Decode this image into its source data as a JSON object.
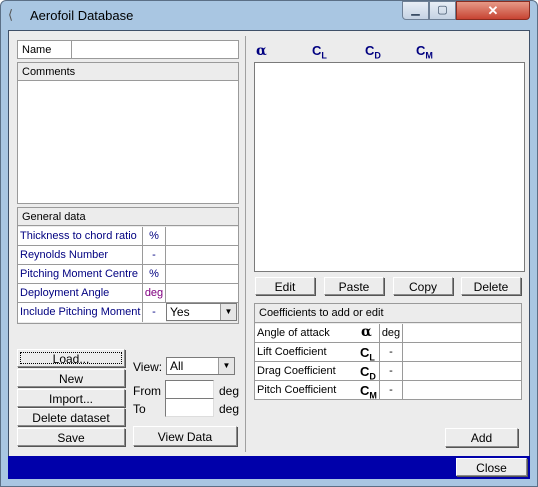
{
  "window": {
    "title": "Aerofoil Database",
    "close_glyph": "✕",
    "min_glyph": "▁",
    "max_glyph": "▢"
  },
  "name_label": "Name",
  "comments_label": "Comments",
  "general": {
    "header": "General data",
    "rows": [
      {
        "label": "Thickness to chord ratio",
        "unit": "%"
      },
      {
        "label": "Reynolds Number",
        "unit": "-"
      },
      {
        "label": "Pitching Moment Centre",
        "unit": "%"
      },
      {
        "label": "Deployment Angle",
        "unit": "deg"
      },
      {
        "label": "Include Pitching Moment",
        "unit": "-"
      }
    ],
    "include_value": "Yes"
  },
  "left_buttons": {
    "load": "Load...",
    "new": "New",
    "import": "Import...",
    "delete": "Delete dataset",
    "save": "Save"
  },
  "view": {
    "label": "View:",
    "value": "All",
    "from": "From",
    "to": "To",
    "deg1": "deg",
    "deg2": "deg",
    "view_data": "View Data"
  },
  "table_headers": {
    "alpha": "α",
    "cl": "C",
    "cl_sub": "L",
    "cd": "C",
    "cd_sub": "D",
    "cm": "C",
    "cm_sub": "M"
  },
  "table_buttons": {
    "edit": "Edit",
    "paste": "Paste",
    "copy": "Copy",
    "delete": "Delete"
  },
  "coeffs": {
    "header": "Coefficients to add or edit",
    "rows": [
      {
        "label": "Angle of attack",
        "sym": "α",
        "unit": "deg"
      },
      {
        "label": "Lift Coefficient",
        "sym": "C",
        "sub": "L",
        "unit": "-"
      },
      {
        "label": "Drag Coefficient",
        "sym": "C",
        "sub": "D",
        "unit": "-"
      },
      {
        "label": "Pitch Coefficient",
        "sym": "C",
        "sub": "M",
        "unit": "-"
      }
    ],
    "add": "Add"
  },
  "close_label": "Close",
  "colors": {
    "title_bar": "#a9c6e2",
    "status_bar": "#0000aa",
    "label_navy": "#000080"
  }
}
